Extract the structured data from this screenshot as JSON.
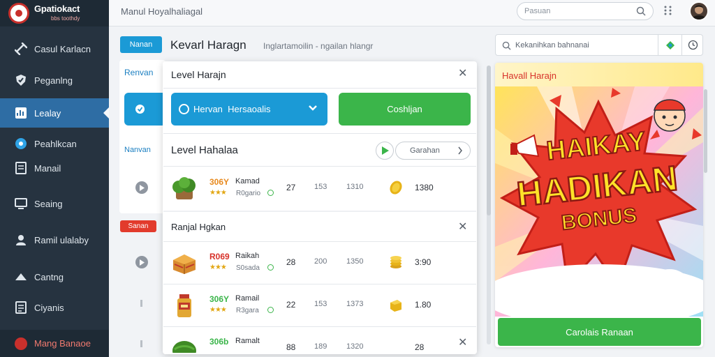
{
  "app": {
    "logo_title": "Gpatiokact",
    "logo_subtitle": "bbs toothdy",
    "breadcrumb": "Manul Hoyalhaliagal",
    "search_placeholder": "Pasuan"
  },
  "sidebar": {
    "items": [
      {
        "label": "Casul Karlacn",
        "icon": "dumbbell-icon"
      },
      {
        "label": "Peganlng",
        "icon": "shield-icon"
      },
      {
        "label": "Lealay",
        "icon": "chart-icon",
        "active": true
      },
      {
        "label": "Peahlkcan",
        "icon": "circle-dot-icon"
      },
      {
        "label": "Manail",
        "icon": "document-icon"
      },
      {
        "label": "Seaing",
        "icon": "monitor-icon"
      },
      {
        "label": "Ramil ulalaby",
        "icon": "person-icon"
      },
      {
        "label": "Cantng",
        "icon": "people-icon"
      },
      {
        "label": "Ciyanis",
        "icon": "document-icon"
      }
    ],
    "footer_label": "Mang Banaoe"
  },
  "main": {
    "pill_label": "Nanan",
    "heading": "Kevarl Haragn",
    "heading_sub": "Inglartamoilin - ngailan hlangr",
    "left_tab_label": "Renvan",
    "left_label_2": "Nanvan",
    "left_red_pill": "Sanan"
  },
  "popup": {
    "title": "Level Harajn",
    "select_label": "Hervan  Hersaoalis",
    "green_button": "Coshljan",
    "section1_title": "Level Hahalaa",
    "section1_button": "Garahan",
    "section2_title": "Ranjal Hgkan",
    "rows_group1": [
      {
        "code": "306Y",
        "code_color": "#e7891d",
        "name": "Kamad",
        "sub": "R0gario",
        "c1": "27",
        "c2": "153",
        "c3": "1310",
        "c4": "1380",
        "item": "broccoli"
      }
    ],
    "rows_group2": [
      {
        "code": "R069",
        "code_color": "#d7322a",
        "name": "Raikah",
        "sub": "S0sada",
        "c1": "28",
        "c2": "200",
        "c3": "1350",
        "c4": "3:90",
        "item": "cake"
      },
      {
        "code": "306Y",
        "code_color": "#3bb54a",
        "name": "Ramail",
        "sub": "R3gara",
        "c1": "22",
        "c2": "153",
        "c3": "1373",
        "c4": "1.80",
        "item": "bottle"
      },
      {
        "code": "306b",
        "code_color": "#3bb54a",
        "name": "Ramalt",
        "sub": "",
        "c1": "88",
        "c2": "189",
        "c3": "1320",
        "c4": "28",
        "item": "melon"
      }
    ]
  },
  "promo": {
    "search_placeholder": "Kekanihkan bahnanai",
    "title": "Havall Harajn",
    "banner_line1": "HAIKAY",
    "banner_line2": "HADIKAN",
    "banner_line3": "BONUS",
    "button": "Carolais Ranaan"
  },
  "colors": {
    "sidebar_bg": "#263340",
    "accent_blue": "#1b9ad6",
    "accent_green": "#3bb54a",
    "accent_red": "#d7322a"
  }
}
